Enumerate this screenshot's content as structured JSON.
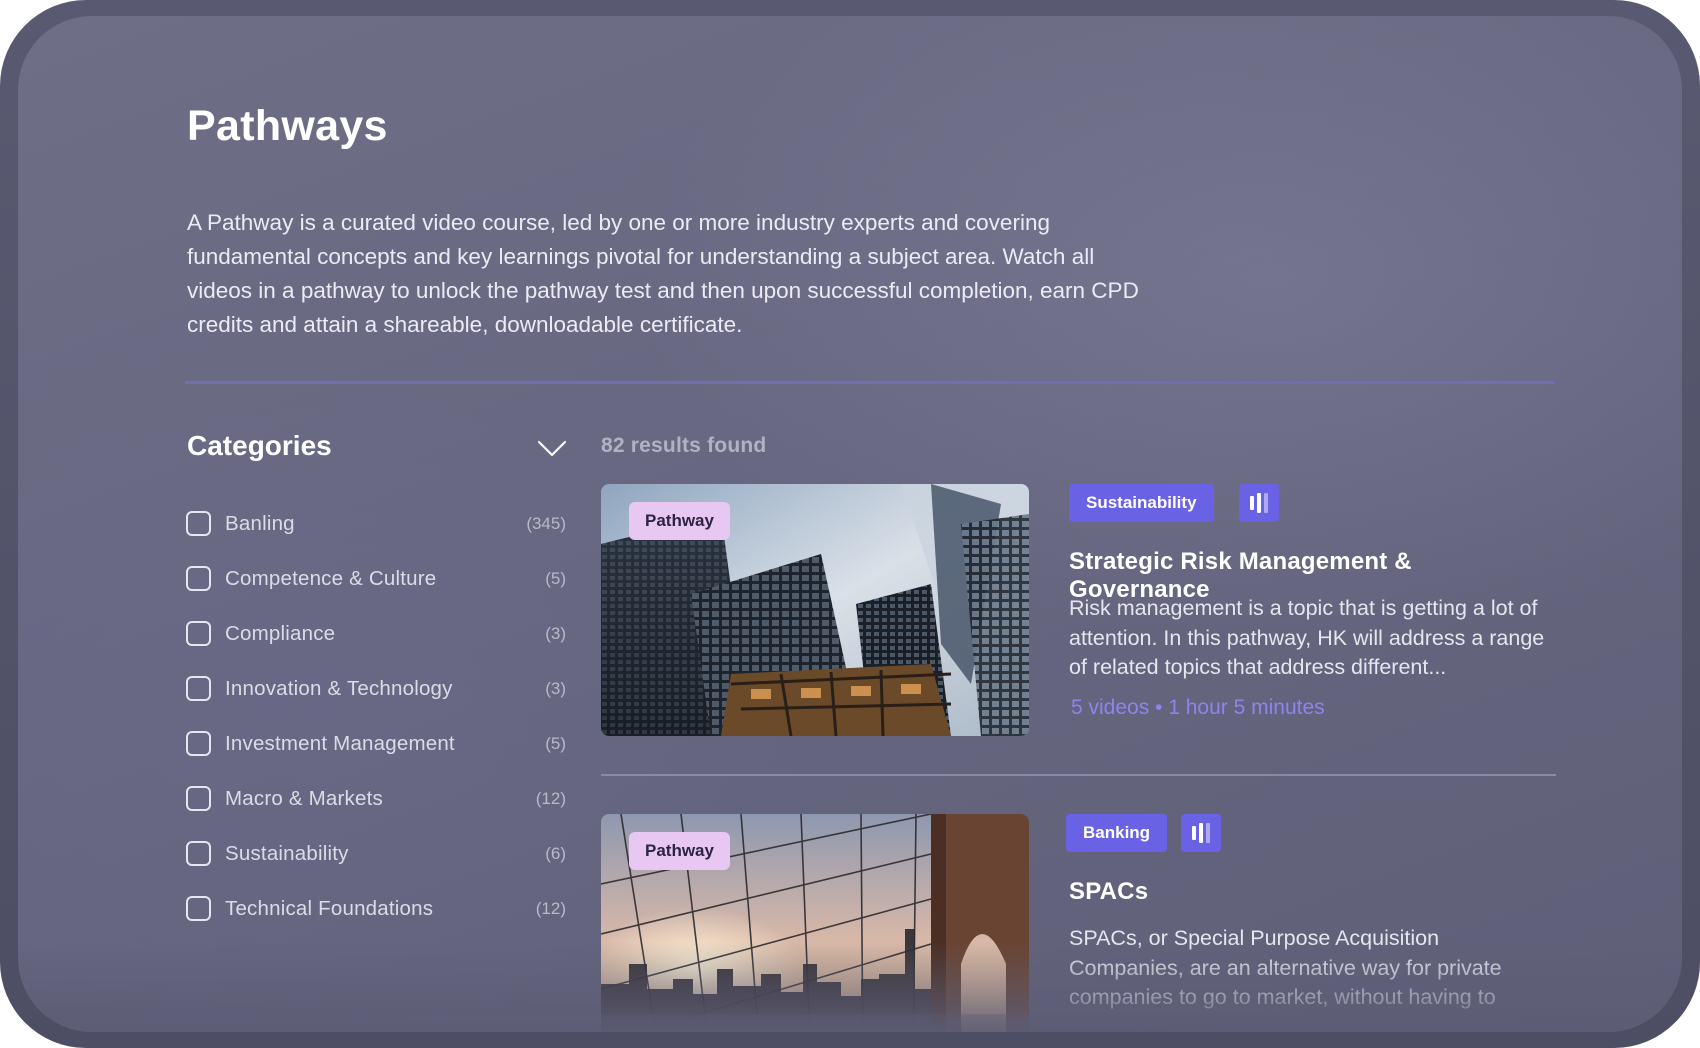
{
  "page": {
    "title": "Pathways",
    "intro": "A Pathway is a curated video course, led by one or more industry experts and covering fundamental concepts and key learnings pivotal for understanding a subject area. Watch all videos in a pathway to unlock the pathway test and then upon successful completion, earn CPD credits and attain a shareable, downloadable certificate."
  },
  "sidebar": {
    "heading": "Categories",
    "toggle_icon": "chevron-down-icon",
    "items": [
      {
        "label": "Banling",
        "count": "(345)"
      },
      {
        "label": "Competence & Culture",
        "count": "(5)"
      },
      {
        "label": "Compliance",
        "count": "(3)"
      },
      {
        "label": "Innovation & Technology",
        "count": "(3)"
      },
      {
        "label": "Investment Management",
        "count": "(5)"
      },
      {
        "label": "Macro & Markets",
        "count": "(12)"
      },
      {
        "label": "Sustainability",
        "count": "(6)"
      },
      {
        "label": "Technical Foundations",
        "count": "(12)"
      }
    ]
  },
  "results": {
    "count_text": "82 results found",
    "cards": [
      {
        "badge": "Pathway",
        "tag": "Sustainability",
        "level_icon": "level-bars-icon",
        "title": "Strategic Risk Management & Governance",
        "description": "Risk management is a topic that is getting a lot of attention. In this pathway, HK will address a range of related topics that address different...",
        "meta": "5 videos • 1 hour 5 minutes",
        "image": "skyscrapers-upward-view"
      },
      {
        "badge": "Pathway",
        "tag": "Banking",
        "level_icon": "level-bars-icon",
        "title": "SPACs",
        "description": "SPACs, or Special Purpose Acquisition Companies, are an alternative way for private companies to go to market, without having to",
        "image": "bridge-cables-city-sunset"
      }
    ]
  },
  "colors": {
    "accent": "#6a62e4",
    "badge": "#e8c8f2",
    "meta": "#8d84f0",
    "divider": "#6f6fb4"
  }
}
